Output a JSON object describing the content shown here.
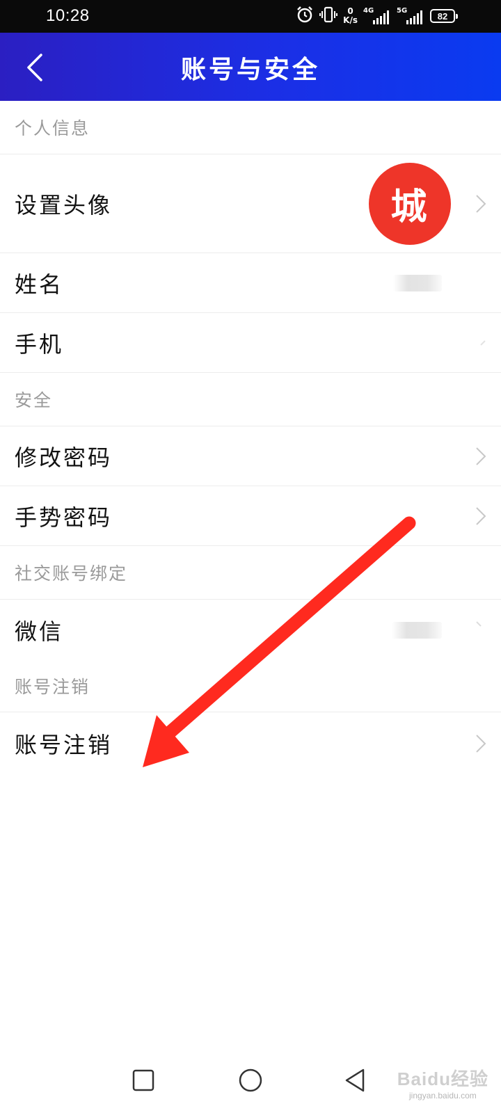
{
  "status_bar": {
    "time": "10:28",
    "speed_value": "0",
    "speed_unit": "K/s",
    "net1": "4G",
    "net2": "5G",
    "battery": "82"
  },
  "header": {
    "title": "账号与安全",
    "back_icon": "chevron-left-icon"
  },
  "sections": {
    "personal": "个人信息",
    "security": "安全",
    "social": "社交账号绑定",
    "cancel": "账号注销"
  },
  "rows": {
    "avatar": {
      "label": "设置头像",
      "avatar_char": "城",
      "avatar_color": "#ee3529"
    },
    "name": {
      "label": "姓名"
    },
    "phone": {
      "label": "手机"
    },
    "change_password": {
      "label": "修改密码"
    },
    "gesture_password": {
      "label": "手势密码"
    },
    "wechat": {
      "label": "微信"
    },
    "cancel_account": {
      "label": "账号注销"
    }
  },
  "annotation": {
    "arrow_color": "#ff2a1f"
  },
  "nav_bar": {
    "recent_icon": "square-icon",
    "home_icon": "circle-icon",
    "back_icon": "triangle-back-icon"
  },
  "watermark": {
    "main": "Baidu经验",
    "sub": "jingyan.baidu.com"
  },
  "colors": {
    "header_gradient_start": "#2b1fc2",
    "header_gradient_end": "#0a3bf0",
    "section_text": "#9a9a9a"
  }
}
